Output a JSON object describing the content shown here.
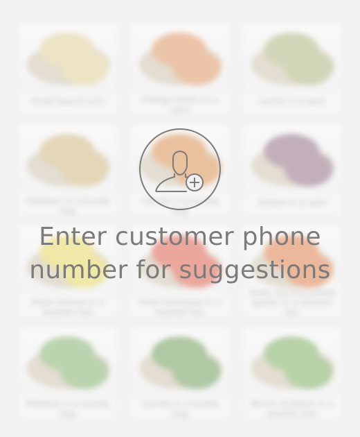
{
  "headline": {
    "line1": "Enter customer phone",
    "line2": "number for suggestions"
  },
  "products": [
    {
      "caption": "Small bag of corn",
      "tone": "#e8d9a0"
    },
    {
      "caption": "Orange lentils in a sack",
      "tone": "#e8a06c"
    },
    {
      "caption": "Lentils in a sack",
      "tone": "#b9bf8a"
    },
    {
      "caption": "Potatoes in a burlap bag",
      "tone": "#d9c28a"
    },
    {
      "caption": "Carrots in a burlap bag",
      "tone": "#e59a5b"
    },
    {
      "caption": "Onions in a sack",
      "tone": "#9b7a8e"
    },
    {
      "caption": "Fresh lemons in a wooden box",
      "tone": "#eee06a"
    },
    {
      "caption": "Fresh tomatoes in a wooden box",
      "tone": "#e66a55"
    },
    {
      "caption": "Fresh red and yellow apples in a wooden box",
      "tone": "#e88a55"
    },
    {
      "caption": "Potatoes in a burlap bag",
      "tone": "#8fbb78"
    },
    {
      "caption": "Carrots in a burlap bag",
      "tone": "#7aa866"
    },
    {
      "caption": "Bunch of beans in a wooden box",
      "tone": "#89b86c"
    }
  ],
  "colors": {
    "background": "#f2f2f2",
    "headline": "#7b7b7b",
    "icon_stroke": "#7b7b7b"
  },
  "icons": {
    "add_customer": "add-user-icon"
  }
}
